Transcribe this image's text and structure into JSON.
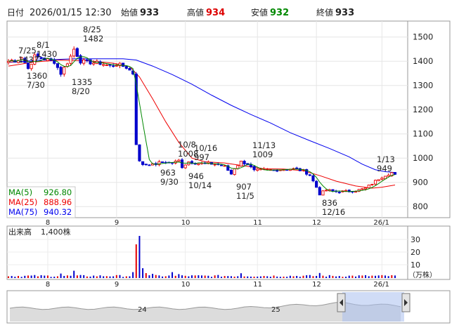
{
  "header": {
    "date_label": "日付",
    "datetime": "2026/01/15 12:30",
    "open_label": "始値",
    "open": "933",
    "high_label": "高値",
    "high": "934",
    "low_label": "安値",
    "low": "932",
    "close_label": "終値",
    "close": "933"
  },
  "colors": {
    "up": "#e60000",
    "down": "#0000cc",
    "high_text": "#dd0000",
    "low_text": "#008800",
    "ma5": "#008800",
    "ma25": "#ee0000",
    "ma75": "#0000ee",
    "volume": "#0000cc",
    "navigator_area": "#a9c0ee"
  },
  "legend": {
    "ma5_label": "MA(5)",
    "ma5_value": "926.80",
    "ma25_label": "MA(25)",
    "ma25_value": "888.96",
    "ma75_label": "MA(75)",
    "ma75_value": "940.32"
  },
  "volume_panel": {
    "label": "出来高",
    "value": "1,400株",
    "ticks": [
      "30",
      "20",
      "10"
    ],
    "unit": "（万株）"
  },
  "navigator": {
    "labels": [
      "24",
      "25"
    ]
  },
  "annotations": [
    {
      "d": 0,
      "lines": [
        "7/25",
        "1437"
      ]
    },
    {
      "d": 3,
      "lines": [
        "8/1",
        "1430"
      ]
    },
    {
      "d": 6,
      "lines": [
        "1360",
        "7/30"
      ]
    },
    {
      "d": 20,
      "lines": [
        "8/25",
        "1482"
      ]
    },
    {
      "d": 16,
      "lines": [
        "1335",
        "8/20"
      ]
    },
    {
      "d": 44,
      "lines": [
        "963",
        "9/30"
      ]
    },
    {
      "d": 52,
      "lines": [
        "10/8",
        "1008"
      ]
    },
    {
      "d": 55,
      "lines": [
        "10/16",
        "997"
      ]
    },
    {
      "d": 50,
      "lines": [
        "946",
        "10/14"
      ]
    },
    {
      "d": 71,
      "lines": [
        "11/13",
        "1009"
      ]
    },
    {
      "d": 68,
      "lines": [
        "907",
        "11/5"
      ]
    },
    {
      "d": 95,
      "lines": [
        "836",
        "12/16"
      ]
    },
    {
      "d": 117,
      "lines": [
        "1/13",
        "949"
      ]
    }
  ],
  "chart_data": {
    "type": "candlestick",
    "period": "2025/07/15 – 2026/01/15 (daily)",
    "ylim": [
      760,
      1560
    ],
    "yticks": [
      800,
      900,
      1000,
      1100,
      1200,
      1300,
      1400,
      1500
    ],
    "x_month_labels": [
      {
        "label": "8",
        "d": 12
      },
      {
        "label": "9",
        "d": 33
      },
      {
        "label": "10",
        "d": 54
      },
      {
        "label": "11",
        "d": 76
      },
      {
        "label": "12",
        "d": 94
      },
      {
        "label": "26/1",
        "d": 114
      }
    ],
    "anchors": [
      {
        "d": 0,
        "close": 1400
      },
      {
        "d": 1,
        "close": 1405
      },
      {
        "d": 2,
        "close": 1395
      },
      {
        "d": 3,
        "close": 1410
      },
      {
        "d": 4,
        "close": 1420
      },
      {
        "d": 6,
        "close": 1370
      },
      {
        "d": 8,
        "close": 1420
      },
      {
        "d": 10,
        "close": 1412
      },
      {
        "d": 12,
        "close": 1405
      },
      {
        "d": 14,
        "close": 1398
      },
      {
        "d": 16,
        "close": 1350
      },
      {
        "d": 18,
        "close": 1395
      },
      {
        "d": 19,
        "close": 1420
      },
      {
        "d": 20,
        "close": 1450
      },
      {
        "d": 22,
        "close": 1400
      },
      {
        "d": 25,
        "close": 1395
      },
      {
        "d": 28,
        "close": 1392
      },
      {
        "d": 31,
        "close": 1380
      },
      {
        "d": 33,
        "close": 1388
      },
      {
        "d": 36,
        "close": 1375
      },
      {
        "d": 38,
        "close": 1350
      },
      {
        "d": 39,
        "close": 1060
      },
      {
        "d": 40,
        "close": 985
      },
      {
        "d": 41,
        "close": 975
      },
      {
        "d": 43,
        "close": 975
      },
      {
        "d": 44,
        "close": 972
      },
      {
        "d": 47,
        "close": 985
      },
      {
        "d": 50,
        "close": 980
      },
      {
        "d": 52,
        "close": 990
      },
      {
        "d": 53,
        "close": 965
      },
      {
        "d": 55,
        "close": 985
      },
      {
        "d": 58,
        "close": 978
      },
      {
        "d": 61,
        "close": 978
      },
      {
        "d": 64,
        "close": 974
      },
      {
        "d": 66,
        "close": 965
      },
      {
        "d": 68,
        "close": 935
      },
      {
        "d": 69,
        "close": 960
      },
      {
        "d": 71,
        "close": 985
      },
      {
        "d": 73,
        "close": 975
      },
      {
        "d": 75,
        "close": 948
      },
      {
        "d": 78,
        "close": 952
      },
      {
        "d": 81,
        "close": 950
      },
      {
        "d": 84,
        "close": 955
      },
      {
        "d": 87,
        "close": 955
      },
      {
        "d": 90,
        "close": 948
      },
      {
        "d": 92,
        "close": 930
      },
      {
        "d": 94,
        "close": 880
      },
      {
        "d": 95,
        "close": 852
      },
      {
        "d": 97,
        "close": 868
      },
      {
        "d": 100,
        "close": 862
      },
      {
        "d": 103,
        "close": 862
      },
      {
        "d": 106,
        "close": 866
      },
      {
        "d": 109,
        "close": 875
      },
      {
        "d": 111,
        "close": 895
      },
      {
        "d": 113,
        "close": 915
      },
      {
        "d": 115,
        "close": 930
      },
      {
        "d": 117,
        "close": 940
      },
      {
        "d": 118,
        "close": 933
      }
    ],
    "ma25_points": [
      [
        0,
        1380
      ],
      [
        8,
        1397
      ],
      [
        16,
        1405
      ],
      [
        24,
        1402
      ],
      [
        32,
        1392
      ],
      [
        37,
        1378
      ],
      [
        40,
        1335
      ],
      [
        44,
        1245
      ],
      [
        48,
        1150
      ],
      [
        52,
        1065
      ],
      [
        56,
        1000
      ],
      [
        60,
        985
      ],
      [
        66,
        980
      ],
      [
        72,
        968
      ],
      [
        78,
        956
      ],
      [
        84,
        955
      ],
      [
        90,
        948
      ],
      [
        95,
        928
      ],
      [
        100,
        905
      ],
      [
        106,
        885
      ],
      [
        111,
        876
      ],
      [
        114,
        880
      ],
      [
        118,
        888.96
      ]
    ],
    "ma75_points": [
      [
        0,
        1395
      ],
      [
        10,
        1405
      ],
      [
        20,
        1410
      ],
      [
        30,
        1410
      ],
      [
        35,
        1410
      ],
      [
        39,
        1405
      ],
      [
        44,
        1380
      ],
      [
        50,
        1345
      ],
      [
        56,
        1305
      ],
      [
        62,
        1260
      ],
      [
        68,
        1218
      ],
      [
        74,
        1180
      ],
      [
        80,
        1145
      ],
      [
        86,
        1105
      ],
      [
        92,
        1072
      ],
      [
        98,
        1040
      ],
      [
        104,
        1005
      ],
      [
        108,
        975
      ],
      [
        112,
        952
      ],
      [
        115,
        944
      ],
      [
        118,
        940.32
      ]
    ],
    "volume_spikes": [
      {
        "d": 0,
        "v": 1.2
      },
      {
        "d": 16,
        "v": 3.2
      },
      {
        "d": 20,
        "v": 5.2
      },
      {
        "d": 38,
        "v": 4.2
      },
      {
        "d": 39,
        "v": 24
      },
      {
        "d": 40,
        "v": 30
      },
      {
        "d": 41,
        "v": 7
      },
      {
        "d": 42,
        "v": 3.5
      },
      {
        "d": 44,
        "v": 3.0
      },
      {
        "d": 50,
        "v": 4.2
      },
      {
        "d": 52,
        "v": 2.8
      },
      {
        "d": 71,
        "v": 3.4
      },
      {
        "d": 95,
        "v": 3.6
      }
    ],
    "volume_ylim": [
      0,
      35
    ],
    "volume_unit": "万株"
  }
}
